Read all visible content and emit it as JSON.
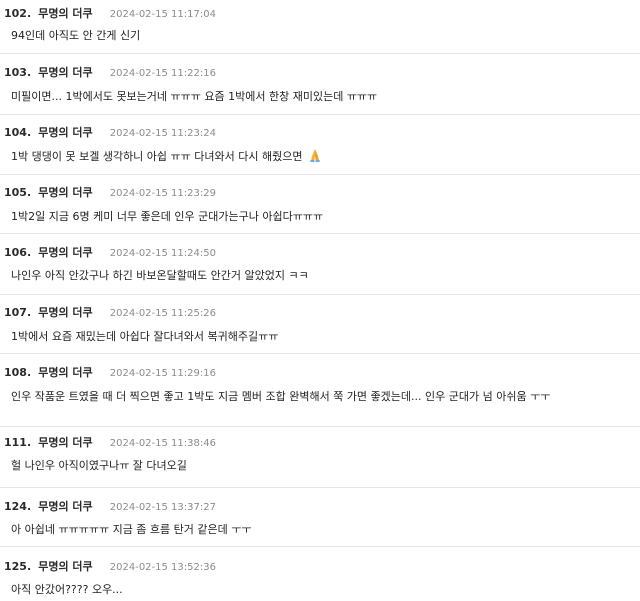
{
  "comments": [
    {
      "num": "102.",
      "author": "무명의 더쿠",
      "time": "2024-02-15 11:17:04",
      "text": "94인데 아직도 안 간게 신기"
    },
    {
      "num": "103.",
      "author": "무명의 더쿠",
      "time": "2024-02-15 11:22:16",
      "text": "미필이면... 1박에서도 못보는거네 ㅠㅠㅠ 요즘 1박에서 한창 재미있는데 ㅠㅠㅠ"
    },
    {
      "num": "104.",
      "author": "무명의 더쿠",
      "time": "2024-02-15 11:23:24",
      "text": "1박 댕댕이 못 보겔 생각하니 아쉽 ㅠㅠ 다녀와서 다시 해줬으면",
      "emoji": "folded-hands-icon"
    },
    {
      "num": "105.",
      "author": "무명의 더쿠",
      "time": "2024-02-15 11:23:29",
      "text": "1박2일 지금 6명 케미 너무 좋은데 인우 군대가는구나 아쉽다ㅠㅠㅠ"
    },
    {
      "num": "106.",
      "author": "무명의 더쿠",
      "time": "2024-02-15 11:24:50",
      "text": "나인우 아직 안갔구나 하긴 바보온달할때도 안간거 알았었지 ㅋㅋ"
    },
    {
      "num": "107.",
      "author": "무명의 더쿠",
      "time": "2024-02-15 11:25:26",
      "text": "1박에서 요즘 재밌는데 아쉽다 잘다녀와서 복귀해주길ㅠㅠ"
    },
    {
      "num": "108.",
      "author": "무명의 더쿠",
      "time": "2024-02-15 11:29:16",
      "text": "인우 작품운 트였을 때 더 찍으면 좋고 1박도 지금 멤버 조합 완벽해서 쭉 가면 좋겠는데... 인우 군대가 넘 아쉬움 ㅜㅜ"
    },
    {
      "num": "111.",
      "author": "무명의 더쿠",
      "time": "2024-02-15 11:38:46",
      "text": "헐 나인우 아직이였구나ㅠ 잘 다녀오길"
    },
    {
      "num": "124.",
      "author": "무명의 더쿠",
      "time": "2024-02-15 13:37:27",
      "text": "아 아쉽네 ㅠㅠㅠㅠㅠ 지금 좀 흐름 탄거 같은데 ㅜㅜ"
    },
    {
      "num": "125.",
      "author": "무명의 더쿠",
      "time": "2024-02-15 13:52:36",
      "text": "아직 안갔어???? 오우..."
    }
  ]
}
